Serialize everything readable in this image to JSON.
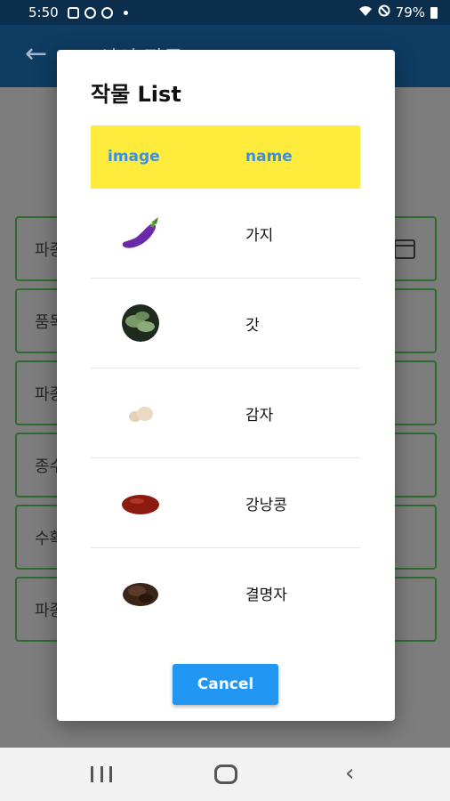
{
  "status_bar": {
    "time": "5:50",
    "battery": "79%"
  },
  "app_bar": {
    "title": "신의 작물"
  },
  "background_fields": [
    {
      "label": "파종"
    },
    {
      "label": "품목"
    },
    {
      "label": "파종"
    },
    {
      "label": "종수"
    },
    {
      "label": "수확"
    },
    {
      "label": "파종"
    }
  ],
  "dialog": {
    "title": "작물 List",
    "columns": {
      "image": "image",
      "name": "name"
    },
    "rows": [
      {
        "name": "가지",
        "image": "eggplant"
      },
      {
        "name": "갓",
        "image": "mustard-leaf"
      },
      {
        "name": "감자",
        "image": "potato"
      },
      {
        "name": "강낭콩",
        "image": "kidney-bean"
      },
      {
        "name": "결명자",
        "image": "cassia-seed"
      }
    ],
    "cancel_label": "Cancel"
  },
  "colors": {
    "header_yellow": "#ffeb3b",
    "header_text": "#3b8fe8",
    "button_blue": "#2196f3",
    "field_border": "#2f6b2f"
  }
}
